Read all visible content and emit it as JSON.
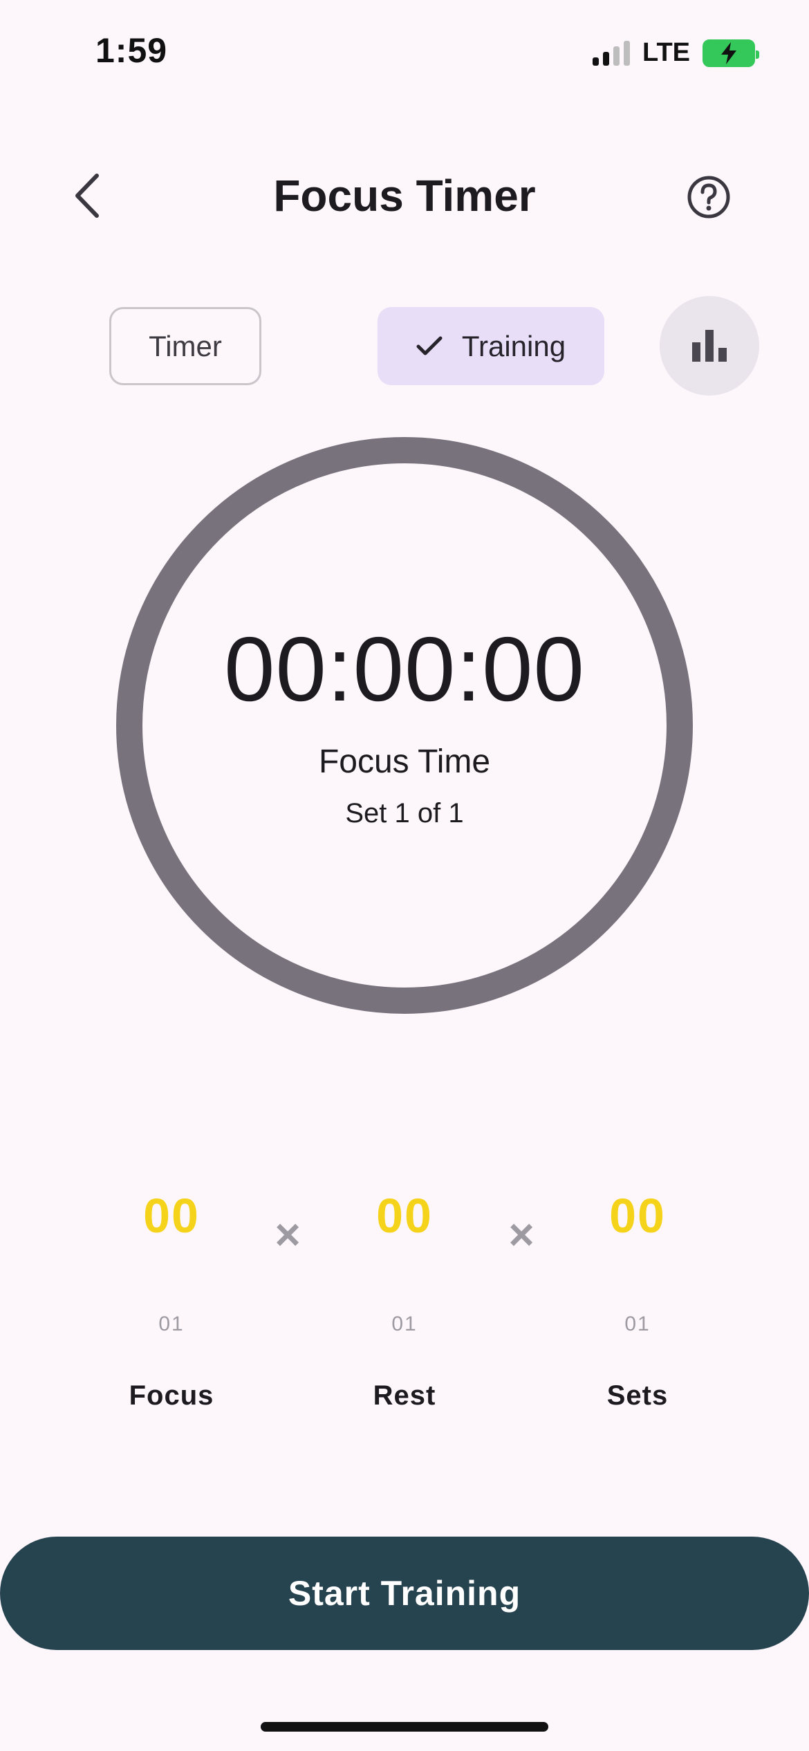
{
  "status_bar": {
    "time": "1:59",
    "network": "LTE",
    "battery_color": "#34C759"
  },
  "app_bar": {
    "title": "Focus Timer",
    "back_icon": "chevron-left-icon",
    "help_icon": "help-circle-icon"
  },
  "mode_toggle": {
    "timer_label": "Timer",
    "training_label": "Training",
    "selected": "Training",
    "selected_color": "#E8DEF7",
    "stats_icon": "bar-chart-icon"
  },
  "timer": {
    "display": "00:00:00",
    "phase": "Focus Time",
    "set_progress": "Set 1 of 1",
    "ring_color": "#77727B"
  },
  "pickers": {
    "focus": {
      "value": "00",
      "next": "01",
      "label": "Focus"
    },
    "rest": {
      "value": "00",
      "next": "01",
      "label": "Rest"
    },
    "sets": {
      "value": "00",
      "next": "01",
      "label": "Sets"
    },
    "separator": "×",
    "value_color": "#F5D31B"
  },
  "actions": {
    "start_label": "Start Training",
    "start_color": "#264450"
  }
}
